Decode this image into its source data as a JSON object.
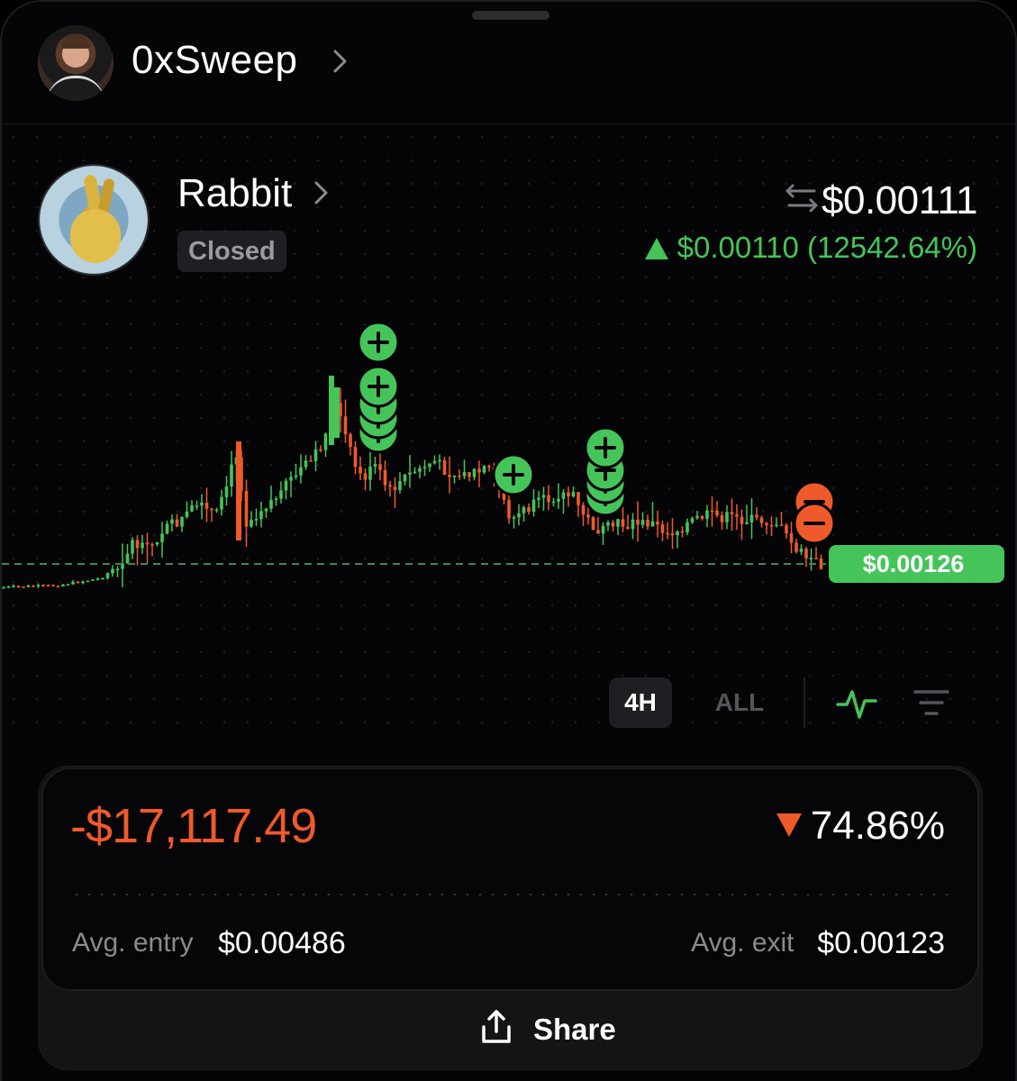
{
  "user": {
    "name": "0xSweep"
  },
  "token": {
    "name": "Rabbit",
    "status": "Closed",
    "price": "$0.00111",
    "change": "$0.00110 (12542.64%)"
  },
  "chart": {
    "current_price_label": "$0.00126",
    "timeframes": [
      "4H",
      "ALL"
    ],
    "active_timeframe": "4H",
    "colors": {
      "up": "#45c45a",
      "down": "#ef5a2a",
      "grid": "#1e1e22"
    }
  },
  "summary": {
    "pnl": "-$17,117.49",
    "pnl_pct": "74.86%",
    "avg_entry_label": "Avg. entry",
    "avg_entry": "$0.00486",
    "avg_exit_label": "Avg. exit",
    "avg_exit": "$0.00123"
  },
  "share": {
    "label": "Share"
  }
}
